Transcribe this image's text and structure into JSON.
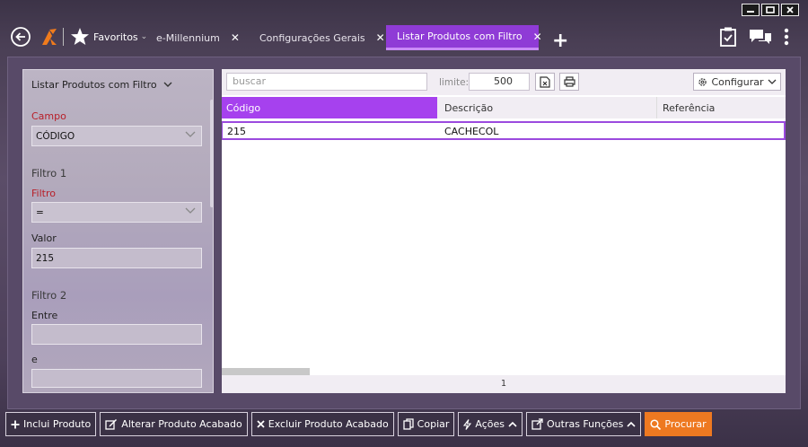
{
  "window_controls": {
    "minimize": "minimize-icon",
    "maximize": "maximize-icon",
    "close": "close-icon"
  },
  "topbar": {
    "favorites_label": "Favoritos",
    "favorites_arrow": "⌄",
    "tabs": [
      {
        "label": "e-Millennium",
        "close": "✕"
      },
      {
        "label": "Configurações Gerais",
        "close": "✕"
      },
      {
        "label": "Listar Produtos com Filtro",
        "close": "✕"
      }
    ],
    "add_tab": "+"
  },
  "sidebar": {
    "title": "Listar Produtos com Filtro",
    "campo_label": "Campo",
    "campo_value": "CÓDIGO",
    "filtro1_label": "Filtro 1",
    "filtro_label": "Filtro",
    "filtro_value": "=",
    "valor_label": "Valor",
    "valor_value": "215",
    "filtro2_label": "Filtro 2",
    "entre_label": "Entre",
    "entre_value": "",
    "e_label": "e",
    "e_value": ""
  },
  "grid": {
    "search_placeholder": "buscar",
    "limit_label": "limite:",
    "limit_value": "500",
    "config_label": "Configurar",
    "columns": [
      "Código",
      "Descrição",
      "Referência"
    ],
    "rows": [
      {
        "codigo": "215",
        "descricao": "CACHECOL",
        "referencia": ""
      }
    ],
    "page": "1"
  },
  "bottombar": {
    "buttons": [
      {
        "label": "Inclui Produto",
        "icon": "plus-icon"
      },
      {
        "label": "Alterar Produto Acabado",
        "icon": "edit-icon"
      },
      {
        "label": "Excluir Produto Acabado",
        "icon": "x-icon"
      },
      {
        "label": "Copiar",
        "icon": "copy-icon"
      },
      {
        "label": "Ações",
        "icon": "bolt-icon"
      },
      {
        "label": "Outras Funções",
        "icon": "external-edit-icon"
      },
      {
        "label": "Procurar",
        "icon": "search-icon"
      }
    ]
  },
  "colors": {
    "accent": "#a641ee",
    "active_tab": "#8f3bd6",
    "procurar": "#ee7921",
    "required_label": "#b81e28"
  }
}
